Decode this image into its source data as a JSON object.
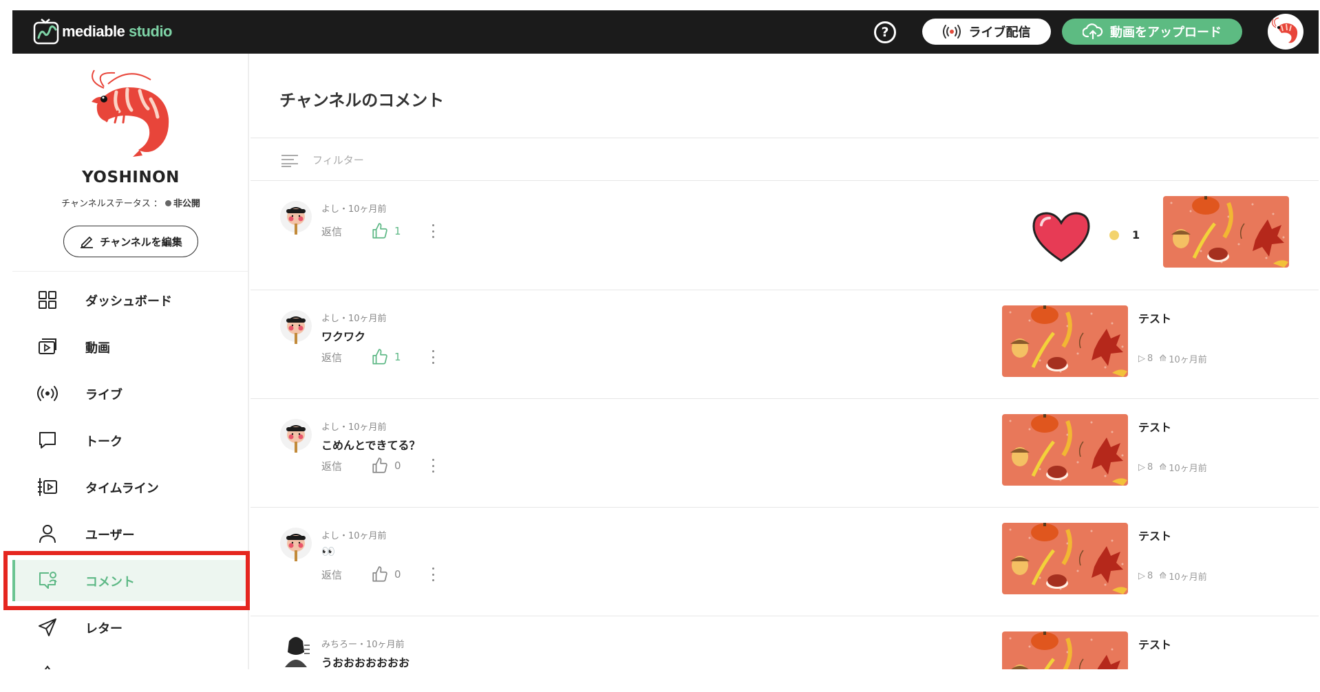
{
  "app": {
    "logo_text": "mediable",
    "logo_accent": "studio"
  },
  "header": {
    "help_label": "?",
    "live_label": "ライブ配信",
    "upload_label": "動画をアップロード"
  },
  "colors": {
    "topbar": "#1b1b1b",
    "accent_green": "#5dbb82",
    "highlight_red": "#e5261f",
    "thumb_orange": "#e8785a"
  },
  "sidebar": {
    "channel_name": "YOSHINON",
    "status_label": "チャンネルステータス ：",
    "status_value": "非公開",
    "edit_button": "チャンネルを編集",
    "items": [
      {
        "label": "ダッシュボード",
        "icon": "dashboard-icon"
      },
      {
        "label": "動画",
        "icon": "video-icon"
      },
      {
        "label": "ライブ",
        "icon": "live-icon"
      },
      {
        "label": "トーク",
        "icon": "talk-icon"
      },
      {
        "label": "タイムライン",
        "icon": "timeline-icon"
      },
      {
        "label": "ユーザー",
        "icon": "user-icon"
      },
      {
        "label": "コメント",
        "icon": "comment-icon",
        "active": true
      },
      {
        "label": "レター",
        "icon": "letter-icon"
      }
    ]
  },
  "main": {
    "title": "チャンネルのコメント",
    "filter_label": "フィルター",
    "reply_label": "返信",
    "comments": [
      {
        "meta": "よし・10ヶ月前",
        "text": "",
        "likes": "1",
        "liked": true,
        "gift_count": "1",
        "video_title": "",
        "video_views": "",
        "video_date": ""
      },
      {
        "meta": "よし・10ヶ月前",
        "text": "ワクワク",
        "likes": "1",
        "liked": true,
        "video_title": "テスト",
        "video_views": "8",
        "video_date": "10ヶ月前"
      },
      {
        "meta": "よし・10ヶ月前",
        "text": "こめんとできてる？",
        "likes": "0",
        "liked": false,
        "video_title": "テスト",
        "video_views": "8",
        "video_date": "10ヶ月前"
      },
      {
        "meta": "よし・10ヶ月前",
        "text": "👀",
        "likes": "0",
        "liked": false,
        "video_title": "テスト",
        "video_views": "8",
        "video_date": "10ヶ月前"
      },
      {
        "meta": "みちろー・10ヶ月前",
        "text": "うおおおおおおお",
        "likes": "",
        "liked": false,
        "video_title": "テスト",
        "video_views": "",
        "video_date": ""
      }
    ]
  }
}
